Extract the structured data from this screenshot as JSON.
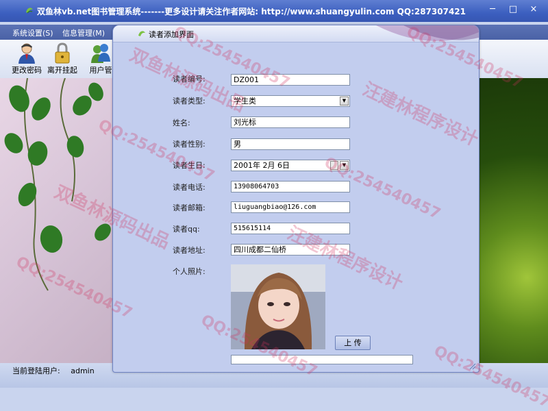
{
  "window": {
    "title": "双鱼林vb.net图书管理系统-------更多设计请关注作者网站:  http://www.shuangyulin.com QQ:287307421",
    "controls": [
      "─",
      "□",
      "×"
    ]
  },
  "menu": [
    "系统设置(S)",
    "信息管理(M)"
  ],
  "toolbar": [
    {
      "label": "更改密码",
      "icon": "user-avatar-icon"
    },
    {
      "label": "离开挂起",
      "icon": "padlock-icon"
    },
    {
      "label": "用户管",
      "icon": "users-group-icon"
    }
  ],
  "status": {
    "label": "当前登陆用户:",
    "user": "admin"
  },
  "dialog": {
    "title": "读者添加界面",
    "fields": {
      "reader_id": {
        "label": "读者编号:",
        "value": "DZ001"
      },
      "reader_type": {
        "label": "读者类型:",
        "value": "学生类"
      },
      "name": {
        "label": "姓名:",
        "value": "刘光标"
      },
      "gender": {
        "label": "读者性别:",
        "value": "男"
      },
      "birthday": {
        "label": "读者生日:",
        "value": "2001年 2月 6日"
      },
      "phone": {
        "label": "读者电话:",
        "value": "13908064703"
      },
      "email": {
        "label": "读者邮箱:",
        "value": "liuguangbiao@126.com"
      },
      "qq": {
        "label": "读者qq:",
        "value": "515615114"
      },
      "address": {
        "label": "读者地址:",
        "value": "四川成都二仙桥"
      },
      "photo": {
        "label": "个人照片:"
      }
    },
    "upload_label": "上 传"
  },
  "watermarks": {
    "brand": "双鱼林源码出品",
    "author": "汪建林程序设计",
    "qq": "QQ:254540457"
  },
  "colors": {
    "title_bar": "#3c5fbf",
    "dialog_bg": "#c2cdee",
    "watermark": "#d22d5f"
  }
}
